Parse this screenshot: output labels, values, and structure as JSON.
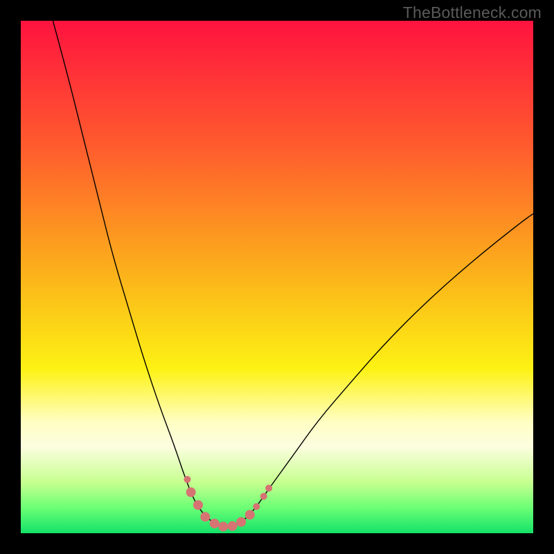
{
  "watermark": "TheBottleneck.com",
  "chart_data": {
    "type": "line",
    "title": "",
    "xlabel": "",
    "ylabel": "",
    "xlim": [
      0,
      100
    ],
    "ylim": [
      0,
      100
    ],
    "gradient_stops": [
      {
        "offset": 0,
        "color": "#ff133f"
      },
      {
        "offset": 25,
        "color": "#ff5d2d"
      },
      {
        "offset": 50,
        "color": "#fcb41a"
      },
      {
        "offset": 68,
        "color": "#fdf214"
      },
      {
        "offset": 78,
        "color": "#fffec0"
      },
      {
        "offset": 83,
        "color": "#fcfee0"
      },
      {
        "offset": 90,
        "color": "#c8ff91"
      },
      {
        "offset": 95,
        "color": "#6cff75"
      },
      {
        "offset": 100,
        "color": "#13e268"
      }
    ],
    "series": [
      {
        "name": "bottleneck-curve",
        "color": "#000000",
        "width": 1.4,
        "points": [
          {
            "x": 6,
            "y": 101
          },
          {
            "x": 9,
            "y": 90
          },
          {
            "x": 12,
            "y": 78
          },
          {
            "x": 15,
            "y": 66
          },
          {
            "x": 18,
            "y": 54
          },
          {
            "x": 21,
            "y": 44
          },
          {
            "x": 24,
            "y": 34
          },
          {
            "x": 27,
            "y": 25
          },
          {
            "x": 30,
            "y": 17
          },
          {
            "x": 32,
            "y": 11
          },
          {
            "x": 34,
            "y": 6
          },
          {
            "x": 36,
            "y": 3.3
          },
          {
            "x": 38,
            "y": 1.8
          },
          {
            "x": 40,
            "y": 1.2
          },
          {
            "x": 42,
            "y": 1.5
          },
          {
            "x": 44,
            "y": 2.9
          },
          {
            "x": 46,
            "y": 5.2
          },
          {
            "x": 49,
            "y": 9.5
          },
          {
            "x": 53,
            "y": 15
          },
          {
            "x": 58,
            "y": 22
          },
          {
            "x": 64,
            "y": 29
          },
          {
            "x": 71,
            "y": 37
          },
          {
            "x": 79,
            "y": 45
          },
          {
            "x": 88,
            "y": 53
          },
          {
            "x": 98,
            "y": 61
          },
          {
            "x": 101,
            "y": 63
          }
        ]
      },
      {
        "name": "highlight-dots",
        "color": "#d67373",
        "type": "scatter",
        "radius_small": 5,
        "radius_large": 7,
        "points": [
          {
            "x": 32.5,
            "y": 10.5,
            "r": "small"
          },
          {
            "x": 33.2,
            "y": 8.0,
            "r": "large"
          },
          {
            "x": 34.6,
            "y": 5.5,
            "r": "large"
          },
          {
            "x": 36.0,
            "y": 3.2,
            "r": "large"
          },
          {
            "x": 37.8,
            "y": 1.9,
            "r": "large"
          },
          {
            "x": 39.5,
            "y": 1.3,
            "r": "large"
          },
          {
            "x": 41.3,
            "y": 1.4,
            "r": "large"
          },
          {
            "x": 43.0,
            "y": 2.2,
            "r": "large"
          },
          {
            "x": 44.7,
            "y": 3.6,
            "r": "large"
          },
          {
            "x": 46.0,
            "y": 5.2,
            "r": "small"
          },
          {
            "x": 47.4,
            "y": 7.2,
            "r": "small"
          },
          {
            "x": 48.4,
            "y": 8.8,
            "r": "small"
          }
        ]
      }
    ]
  }
}
